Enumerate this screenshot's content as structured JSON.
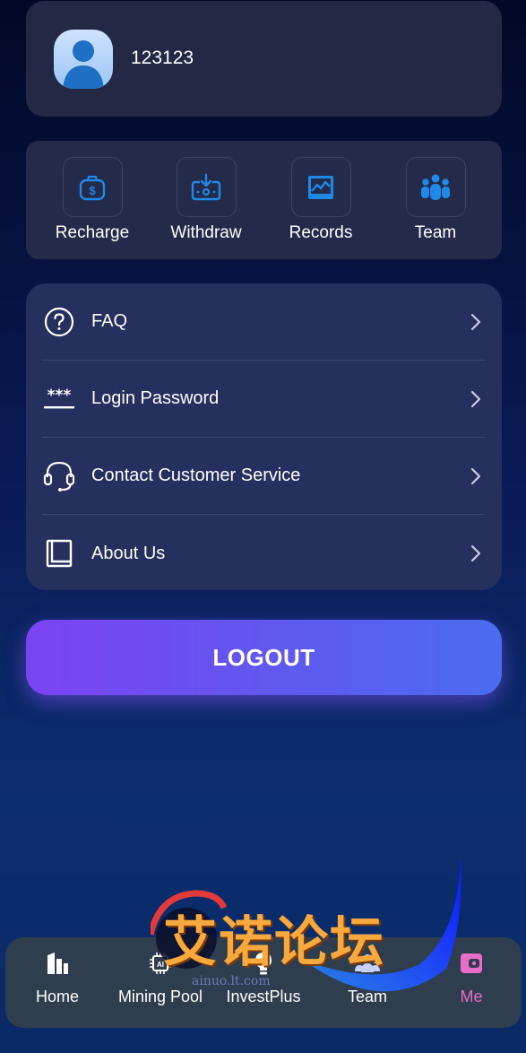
{
  "profile": {
    "username": "123123"
  },
  "quick_actions": [
    {
      "label": "Recharge",
      "icon": "wallet-dollar-icon"
    },
    {
      "label": "Withdraw",
      "icon": "withdraw-icon"
    },
    {
      "label": "Records",
      "icon": "chart-records-icon"
    },
    {
      "label": "Team",
      "icon": "team-icon"
    }
  ],
  "menu": [
    {
      "label": "FAQ",
      "icon": "question-circle-icon"
    },
    {
      "label": "Login Password",
      "icon": "password-icon"
    },
    {
      "label": "Contact Customer Service",
      "icon": "headset-icon"
    },
    {
      "label": "About Us",
      "icon": "book-icon"
    }
  ],
  "logout_label": "LOGOUT",
  "tabbar": {
    "items": [
      {
        "label": "Home",
        "icon": "building-icon"
      },
      {
        "label": "Mining Pool",
        "icon": "ai-chip-icon"
      },
      {
        "label": "InvestPlus",
        "icon": "lightbulb-dollar-icon"
      },
      {
        "label": "Team",
        "icon": "team-icon"
      },
      {
        "label": "Me",
        "icon": "wallet-icon"
      }
    ],
    "active": "Me"
  },
  "watermark": {
    "title": "艾诺论坛",
    "subtitle": "ainuo.lt.com"
  },
  "colors": {
    "accent": "#1e8ae6",
    "active_tab": "#e86cc8",
    "logout_start": "#7b43f2",
    "logout_end": "#4b6cf0"
  }
}
